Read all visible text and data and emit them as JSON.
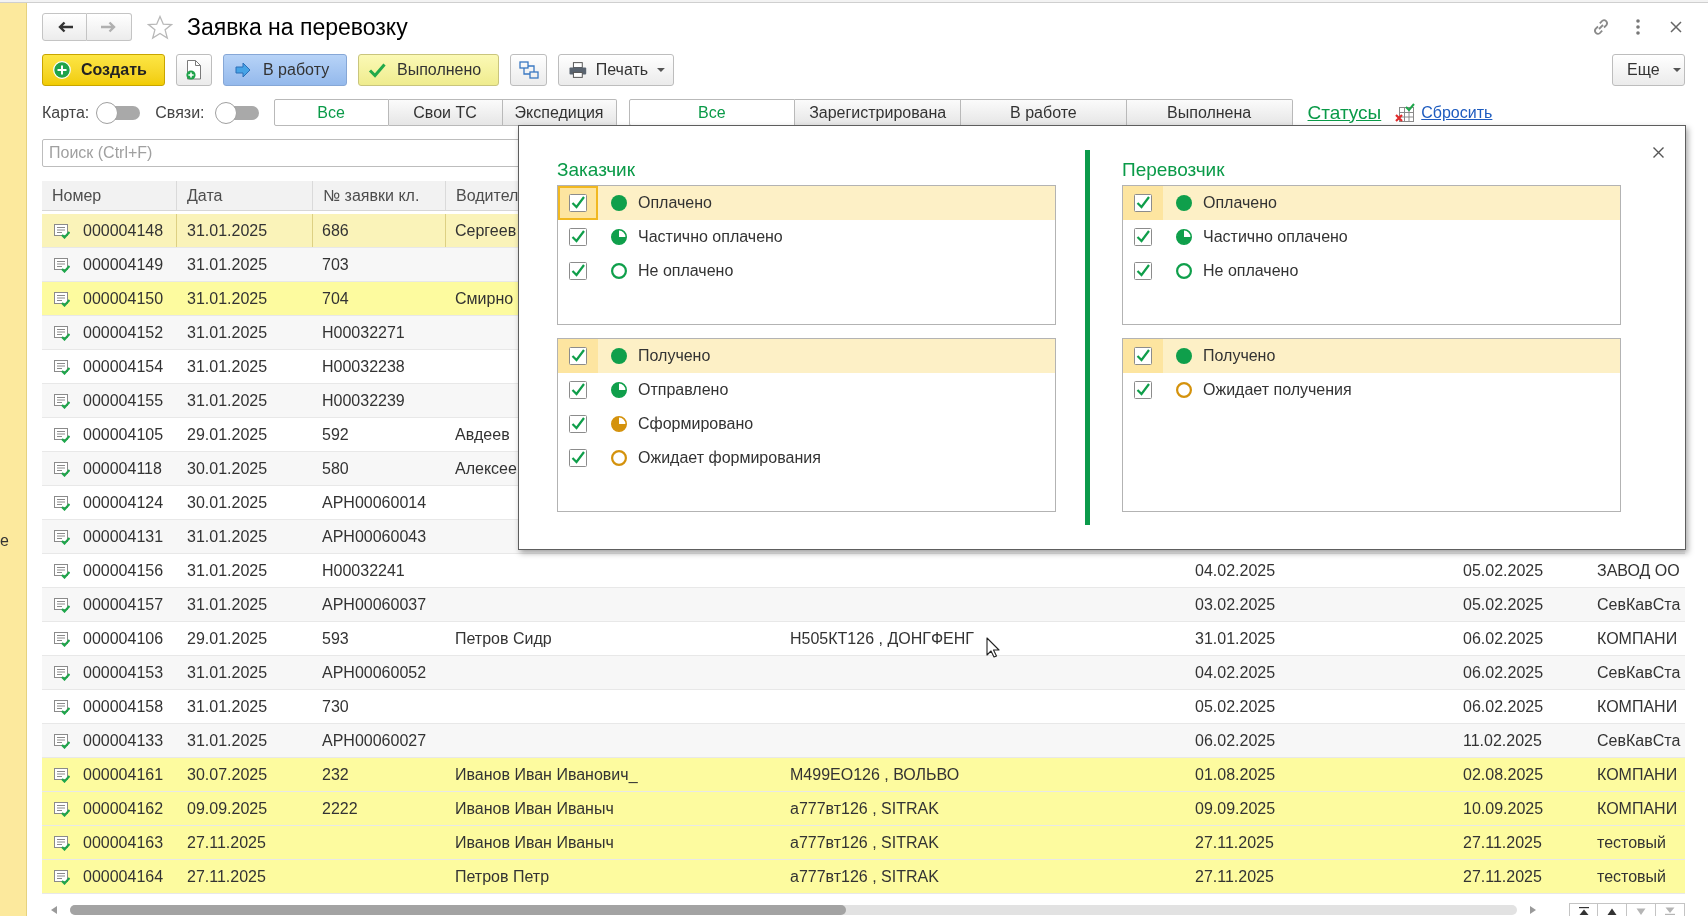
{
  "sidebar": {
    "text": "е"
  },
  "window": {
    "nav": [
      {
        "kind": "back",
        "disabled": false
      },
      {
        "kind": "forward",
        "disabled": true
      }
    ],
    "starred": false,
    "title": "Заявка на перевозку"
  },
  "toolbar": {
    "buttons": [
      {
        "kind": "create",
        "label": "Создать"
      },
      {
        "kind": "new-document"
      },
      {
        "kind": "to-work",
        "label": "В работу"
      },
      {
        "kind": "done",
        "label": "Выполнено"
      },
      {
        "kind": "structure"
      },
      {
        "kind": "print",
        "label": "Печать"
      }
    ],
    "more": "Еще"
  },
  "filters": {
    "toggles": [
      {
        "label": "Карта:",
        "on": false
      },
      {
        "label": "Связи:",
        "on": false
      }
    ],
    "tab_groups": [
      {
        "tabs": [
          {
            "label": "Все",
            "selected": true
          },
          {
            "label": "Свои ТС",
            "selected": false
          },
          {
            "label": "Экспедиция",
            "selected": false
          }
        ]
      },
      {
        "tabs": [
          {
            "label": "Все",
            "selected": true
          },
          {
            "label": "Зарегистрирована",
            "selected": false
          },
          {
            "label": "В работе",
            "selected": false
          },
          {
            "label": "Выполнена",
            "selected": false
          }
        ]
      }
    ],
    "statuses_link": "Статусы",
    "reset_link": "Сбросить"
  },
  "search": {
    "placeholder": "Поиск (Ctrl+F)"
  },
  "table": {
    "columns": [
      "Номер",
      "Дата",
      "№ заявки кл.",
      "Водител"
    ],
    "rows": [
      {
        "number": "000004148",
        "date": "31.01.2025",
        "request_no": "686",
        "driver": "Сергеев",
        "selected": true,
        "highlighted": false
      },
      {
        "number": "000004149",
        "date": "31.01.2025",
        "request_no": "703",
        "selected": false,
        "highlighted": false
      },
      {
        "number": "000004150",
        "date": "31.01.2025",
        "request_no": "704",
        "driver": "Смирно",
        "selected": false,
        "highlighted": true
      },
      {
        "number": "000004152",
        "date": "31.01.2025",
        "request_no": "Н00032271",
        "selected": false,
        "highlighted": false
      },
      {
        "number": "000004154",
        "date": "31.01.2025",
        "request_no": "Н00032238",
        "selected": false,
        "highlighted": false
      },
      {
        "number": "000004155",
        "date": "31.01.2025",
        "request_no": "Н00032239",
        "selected": false,
        "highlighted": false
      },
      {
        "number": "000004105",
        "date": "29.01.2025",
        "request_no": "592",
        "driver": "Авдеев",
        "selected": false,
        "highlighted": false
      },
      {
        "number": "000004118",
        "date": "30.01.2025",
        "request_no": "580",
        "driver": "Алексее",
        "selected": false,
        "highlighted": false
      },
      {
        "number": "000004124",
        "date": "30.01.2025",
        "request_no": "АРН00060014",
        "selected": false,
        "highlighted": false
      },
      {
        "number": "000004131",
        "date": "31.01.2025",
        "request_no": "АРН00060043",
        "selected": false,
        "highlighted": false
      },
      {
        "number": "000004156",
        "date": "31.01.2025",
        "request_no": "Н00032241",
        "column_6": "04.02.2025",
        "column_7": "05.02.2025",
        "column_8": "ЗАВОД ОО",
        "selected": false,
        "highlighted": false
      },
      {
        "number": "000004157",
        "date": "31.01.2025",
        "request_no": "АРН00060037",
        "column_6": "03.02.2025",
        "column_7": "05.02.2025",
        "column_8": "СевКавСта",
        "selected": false,
        "highlighted": false
      },
      {
        "number": "000004106",
        "date": "29.01.2025",
        "request_no": "593",
        "driver": "Петров Сидр",
        "column_5": "Н505КТ126 , ДОНГФЕНГ",
        "column_6": "31.01.2025",
        "column_7": "06.02.2025",
        "column_8": "КОМПАНИ",
        "selected": false,
        "highlighted": false
      },
      {
        "number": "000004153",
        "date": "31.01.2025",
        "request_no": "АРН00060052",
        "column_6": "04.02.2025",
        "column_7": "06.02.2025",
        "column_8": "СевКавСта",
        "selected": false,
        "highlighted": false
      },
      {
        "number": "000004158",
        "date": "31.01.2025",
        "request_no": "730",
        "column_6": "05.02.2025",
        "column_7": "06.02.2025",
        "column_8": "КОМПАНИ",
        "selected": false,
        "highlighted": false
      },
      {
        "number": "000004133",
        "date": "31.01.2025",
        "request_no": "АРН00060027",
        "column_6": "06.02.2025",
        "column_7": "11.02.2025",
        "column_8": "СевКавСта",
        "selected": false,
        "highlighted": false
      },
      {
        "number": "000004161",
        "date": "30.07.2025",
        "request_no": "232",
        "driver": "Иванов Иван Иванович_",
        "column_5": "М499ЕО126 , ВОЛЬВО",
        "column_6": "01.08.2025",
        "column_7": "02.08.2025",
        "column_8": "КОМПАНИ",
        "selected": false,
        "highlighted": true
      },
      {
        "number": "000004162",
        "date": "09.09.2025",
        "request_no": "2222",
        "driver": "Иванов Иван Иваныч",
        "column_5": "а777вт126 , SITRAK",
        "column_6": "09.09.2025",
        "column_7": "10.09.2025",
        "column_8": "КОМПАНИ",
        "selected": false,
        "highlighted": true
      },
      {
        "number": "000004163",
        "date": "27.11.2025",
        "driver": "Иванов Иван Иваныч",
        "column_5": "а777вт126 , SITRAK",
        "column_6": "27.11.2025",
        "column_7": "27.11.2025",
        "column_8": "тестовый",
        "selected": false,
        "highlighted": true
      },
      {
        "number": "000004164",
        "date": "27.11.2025",
        "driver": "Петров Петр",
        "column_5": "а777вт126 , SITRAK",
        "column_6": "27.11.2025",
        "column_7": "27.11.2025",
        "column_8": "тестовый",
        "selected": false,
        "highlighted": true
      }
    ]
  },
  "popup": {
    "groups": [
      {
        "title": "Заказчик",
        "lists": [
          {
            "items": [
              {
                "label": "Оплачено",
                "kind": "full",
                "color": "#0f9f4b",
                "checked": true,
                "selected": true,
                "focused": true
              },
              {
                "label": "Частично оплачено",
                "kind": "partial",
                "color": "#0f9f4b",
                "checked": true,
                "selected": false,
                "focused": false
              },
              {
                "label": "Не оплачено",
                "kind": "empty",
                "color": "#0f9f4b",
                "checked": true,
                "selected": false,
                "focused": false
              }
            ]
          },
          {
            "items": [
              {
                "label": "Получено",
                "kind": "full",
                "color": "#0f9f4b",
                "checked": true,
                "selected": true,
                "focused": false
              },
              {
                "label": "Отправлено",
                "kind": "partial",
                "color": "#0f9f4b",
                "checked": true,
                "selected": false,
                "focused": false
              },
              {
                "label": "Сформировано",
                "kind": "partial",
                "color": "#d4920c",
                "checked": true,
                "selected": false,
                "focused": false
              },
              {
                "label": "Ожидает формирования",
                "kind": "empty",
                "color": "#d4920c",
                "checked": true,
                "selected": false,
                "focused": false
              }
            ]
          }
        ]
      },
      {
        "title": "Перевозчик",
        "lists": [
          {
            "items": [
              {
                "label": "Оплачено",
                "kind": "full",
                "color": "#0f9f4b",
                "checked": true,
                "selected": true,
                "focused": false
              },
              {
                "label": "Частично оплачено",
                "kind": "partial",
                "color": "#0f9f4b",
                "checked": true,
                "selected": false,
                "focused": false
              },
              {
                "label": "Не оплачено",
                "kind": "empty",
                "color": "#0f9f4b",
                "checked": true,
                "selected": false,
                "focused": false
              }
            ]
          },
          {
            "items": [
              {
                "label": "Получено",
                "kind": "full",
                "color": "#0f9f4b",
                "checked": true,
                "selected": true,
                "focused": false
              },
              {
                "label": "Ожидает получения",
                "kind": "empty",
                "color": "#d4920c",
                "checked": true,
                "selected": false,
                "focused": false
              }
            ]
          }
        ]
      }
    ]
  }
}
